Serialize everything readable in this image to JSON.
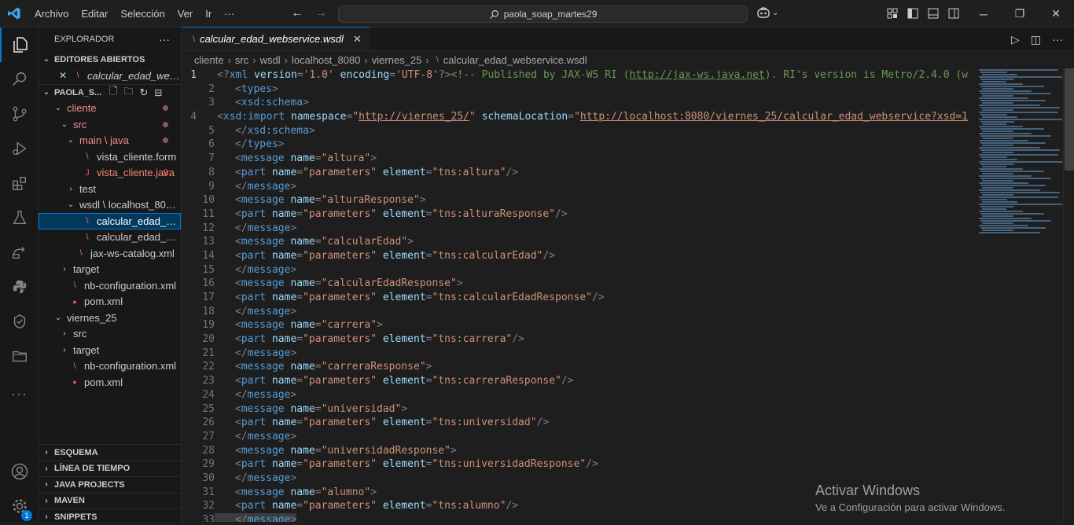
{
  "menu": [
    "Archivo",
    "Editar",
    "Selección",
    "Ver",
    "Ir",
    "···"
  ],
  "search": {
    "text": "paola_soap_martes29"
  },
  "sidebar": {
    "title": "EXPLORADOR",
    "open_editors": {
      "label": "EDITORES ABIERTOS",
      "items": [
        {
          "name": "calcular_edad_web..."
        }
      ]
    },
    "workspace": {
      "label": "PAOLA_S..."
    },
    "tree": [
      {
        "label": "cliente",
        "depth": 1,
        "chevron": "⌄",
        "icon": "",
        "kind": "mod"
      },
      {
        "label": "src",
        "depth": 2,
        "chevron": "⌄",
        "icon": "",
        "kind": "mod"
      },
      {
        "label": "main \\ java",
        "depth": 3,
        "chevron": "⌄",
        "icon": "",
        "kind": "mod"
      },
      {
        "label": "vista_cliente.form",
        "depth": 4,
        "chevron": "",
        "icon": "rss",
        "kind": ""
      },
      {
        "label": "vista_cliente.java",
        "depth": 4,
        "chevron": "",
        "icon": "java",
        "kind": "err",
        "count": "8"
      },
      {
        "label": "test",
        "depth": 3,
        "chevron": "›",
        "icon": "",
        "kind": ""
      },
      {
        "label": "wsdl \\ localhost_8080...",
        "depth": 3,
        "chevron": "⌄",
        "icon": "",
        "kind": ""
      },
      {
        "label": "calcular_edad_webs...",
        "depth": 4,
        "chevron": "",
        "icon": "rss",
        "kind": "",
        "selected": true
      },
      {
        "label": "calcular_edad_webs...",
        "depth": 4,
        "chevron": "",
        "icon": "rss",
        "kind": ""
      },
      {
        "label": "jax-ws-catalog.xml",
        "depth": 3,
        "chevron": "",
        "icon": "rss",
        "kind": ""
      },
      {
        "label": "target",
        "depth": 2,
        "chevron": "›",
        "icon": "",
        "kind": ""
      },
      {
        "label": "nb-configuration.xml",
        "depth": 2,
        "chevron": "",
        "icon": "rss",
        "kind": ""
      },
      {
        "label": "pom.xml",
        "depth": 2,
        "chevron": "",
        "icon": "pom",
        "kind": ""
      },
      {
        "label": "viernes_25",
        "depth": 1,
        "chevron": "⌄",
        "icon": "",
        "kind": ""
      },
      {
        "label": "src",
        "depth": 2,
        "chevron": "›",
        "icon": "",
        "kind": ""
      },
      {
        "label": "target",
        "depth": 2,
        "chevron": "›",
        "icon": "",
        "kind": ""
      },
      {
        "label": "nb-configuration.xml",
        "depth": 2,
        "chevron": "",
        "icon": "rss",
        "kind": ""
      },
      {
        "label": "pom.xml",
        "depth": 2,
        "chevron": "",
        "icon": "pom",
        "kind": ""
      }
    ],
    "bottom_sections": [
      "ESQUEMA",
      "LÍNEA DE TIEMPO",
      "JAVA PROJECTS",
      "MAVEN",
      "SNIPPETS"
    ]
  },
  "activity_badge": "1",
  "tab": {
    "label": "calcular_edad_webservice.wsdl"
  },
  "breadcrumbs": [
    "cliente",
    "src",
    "wsdl",
    "localhost_8080",
    "viernes_25",
    "calcular_edad_webservice.wsdl"
  ],
  "code_lines": [
    "<?xml version='1.0' encoding='UTF-8'?><!-- Published by JAX-WS RI (http://jax-ws.java.net). RI's version is Metro/2.4.0 (w",
    "<types>",
    "<xsd:schema>",
    "<xsd:import namespace=\"http://viernes_25/\" schemaLocation=\"http://localhost:8080/viernes_25/calcular_edad_webservice?xsd=1",
    "</xsd:schema>",
    "</types>",
    "<message name=\"altura\">",
    "<part name=\"parameters\" element=\"tns:altura\"/>",
    "</message>",
    "<message name=\"alturaResponse\">",
    "<part name=\"parameters\" element=\"tns:alturaResponse\"/>",
    "</message>",
    "<message name=\"calcularEdad\">",
    "<part name=\"parameters\" element=\"tns:calcularEdad\"/>",
    "</message>",
    "<message name=\"calcularEdadResponse\">",
    "<part name=\"parameters\" element=\"tns:calcularEdadResponse\"/>",
    "</message>",
    "<message name=\"carrera\">",
    "<part name=\"parameters\" element=\"tns:carrera\"/>",
    "</message>",
    "<message name=\"carreraResponse\">",
    "<part name=\"parameters\" element=\"tns:carreraResponse\"/>",
    "</message>",
    "<message name=\"universidad\">",
    "<part name=\"parameters\" element=\"tns:universidad\"/>",
    "</message>",
    "<message name=\"universidadResponse\">",
    "<part name=\"parameters\" element=\"tns:universidadResponse\"/>",
    "</message>",
    "<message name=\"alumno\">",
    "<part name=\"parameters\" element=\"tns:alumno\"/>",
    "</message>"
  ],
  "current_line": 1,
  "highlight_line": 33,
  "watermark": {
    "line1": "Activar Windows",
    "line2": "Ve a Configuración para activar Windows."
  },
  "colors": {
    "accent": "#0078d4",
    "tag": "#569cd6",
    "attr": "#9cdcfe",
    "string": "#ce9178"
  }
}
